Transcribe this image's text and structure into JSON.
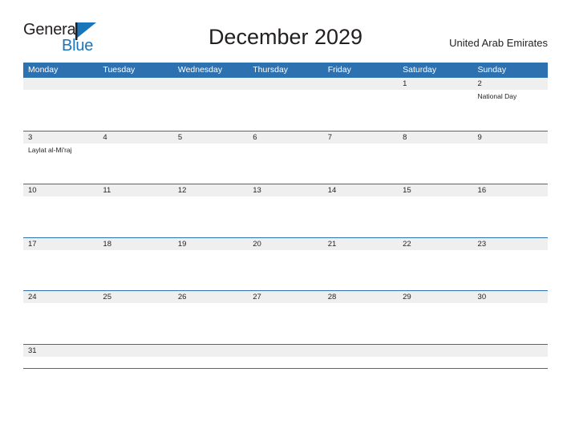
{
  "logo": {
    "text_top": "General",
    "text_bottom": "Blue",
    "mark": "blue-flag-triangle",
    "color_primary": "#231f20",
    "color_accent": "#1a75bb"
  },
  "header": {
    "title": "December 2029",
    "country": "United Arab Emirates"
  },
  "calendar": {
    "accent_color": "#2e71b0",
    "number_band_color": "#efefef",
    "weekdays": [
      "Monday",
      "Tuesday",
      "Wednesday",
      "Thursday",
      "Friday",
      "Saturday",
      "Sunday"
    ],
    "weeks": [
      {
        "days": [
          {
            "num": "",
            "event": ""
          },
          {
            "num": "",
            "event": ""
          },
          {
            "num": "",
            "event": ""
          },
          {
            "num": "",
            "event": ""
          },
          {
            "num": "",
            "event": ""
          },
          {
            "num": "1",
            "event": ""
          },
          {
            "num": "2",
            "event": "National Day"
          }
        ]
      },
      {
        "days": [
          {
            "num": "3",
            "event": "Laylat al-Mi'raj"
          },
          {
            "num": "4",
            "event": ""
          },
          {
            "num": "5",
            "event": ""
          },
          {
            "num": "6",
            "event": ""
          },
          {
            "num": "7",
            "event": ""
          },
          {
            "num": "8",
            "event": ""
          },
          {
            "num": "9",
            "event": ""
          }
        ]
      },
      {
        "days": [
          {
            "num": "10",
            "event": ""
          },
          {
            "num": "11",
            "event": ""
          },
          {
            "num": "12",
            "event": ""
          },
          {
            "num": "13",
            "event": ""
          },
          {
            "num": "14",
            "event": ""
          },
          {
            "num": "15",
            "event": ""
          },
          {
            "num": "16",
            "event": ""
          }
        ]
      },
      {
        "days": [
          {
            "num": "17",
            "event": ""
          },
          {
            "num": "18",
            "event": ""
          },
          {
            "num": "19",
            "event": ""
          },
          {
            "num": "20",
            "event": ""
          },
          {
            "num": "21",
            "event": ""
          },
          {
            "num": "22",
            "event": ""
          },
          {
            "num": "23",
            "event": ""
          }
        ]
      },
      {
        "days": [
          {
            "num": "24",
            "event": ""
          },
          {
            "num": "25",
            "event": ""
          },
          {
            "num": "26",
            "event": ""
          },
          {
            "num": "27",
            "event": ""
          },
          {
            "num": "28",
            "event": ""
          },
          {
            "num": "29",
            "event": ""
          },
          {
            "num": "30",
            "event": ""
          }
        ]
      },
      {
        "days": [
          {
            "num": "31",
            "event": ""
          },
          {
            "num": "",
            "event": ""
          },
          {
            "num": "",
            "event": ""
          },
          {
            "num": "",
            "event": ""
          },
          {
            "num": "",
            "event": ""
          },
          {
            "num": "",
            "event": ""
          },
          {
            "num": "",
            "event": ""
          }
        ]
      }
    ]
  }
}
